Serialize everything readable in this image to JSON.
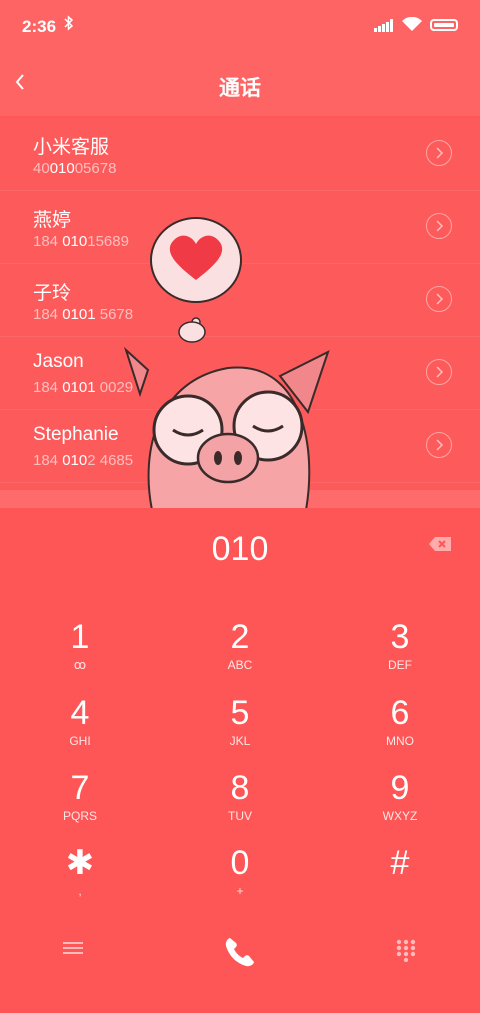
{
  "status": {
    "time": "2:36"
  },
  "header": {
    "title": "通话"
  },
  "contacts": [
    {
      "name": "小米客服",
      "pre": "40",
      "match": "010",
      "post": "05678"
    },
    {
      "name": "燕婷",
      "pre": "184 ",
      "match": "010",
      "post": "15689"
    },
    {
      "name": "子玲",
      "pre": "184 ",
      "match": "0101",
      "post": " 5678"
    },
    {
      "name": "Jason",
      "pre": "184 ",
      "match": "0101",
      "post": " 0029"
    },
    {
      "name": "Stephanie",
      "pre": "184 ",
      "match": "010",
      "post": "2 4685"
    }
  ],
  "dialer": {
    "entry": "010",
    "keys": [
      {
        "digit": "1",
        "letters": "ꝏ"
      },
      {
        "digit": "2",
        "letters": "ABC"
      },
      {
        "digit": "3",
        "letters": "DEF"
      },
      {
        "digit": "4",
        "letters": "GHI"
      },
      {
        "digit": "5",
        "letters": "JKL"
      },
      {
        "digit": "6",
        "letters": "MNO"
      },
      {
        "digit": "7",
        "letters": "PQRS"
      },
      {
        "digit": "8",
        "letters": "TUV"
      },
      {
        "digit": "9",
        "letters": "WXYZ"
      },
      {
        "digit": "✱",
        "letters": ","
      },
      {
        "digit": "0",
        "letters": "+"
      },
      {
        "digit": "#",
        "letters": ""
      }
    ]
  },
  "colors": {
    "background": "#fe5656",
    "header": "#ff6464",
    "heart": "#f03a45"
  }
}
